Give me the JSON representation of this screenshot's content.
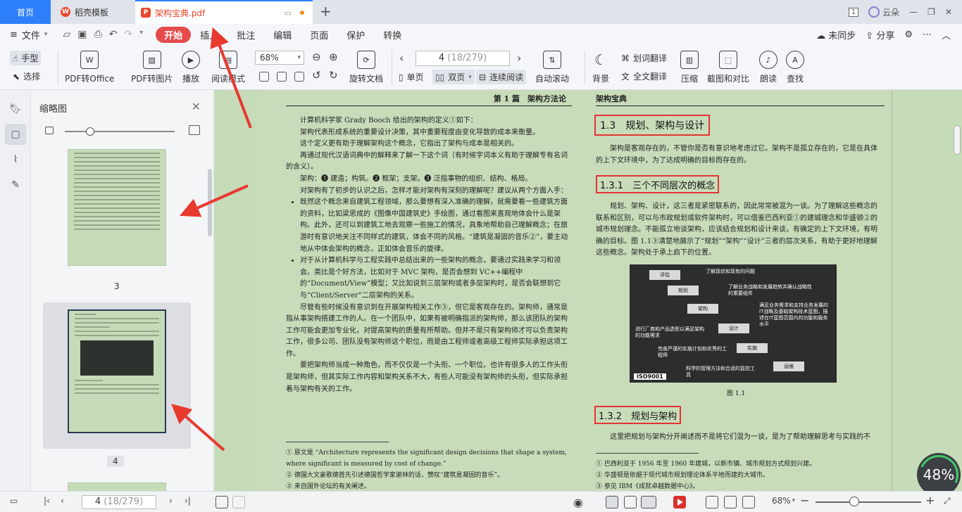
{
  "tabs": {
    "home": "首页",
    "template": "稻壳模板",
    "pdf": "架构宝典.pdf",
    "page_badge": "1",
    "user": "云朵"
  },
  "menu": {
    "file": "文件",
    "tabs": [
      "开始",
      "插入",
      "批注",
      "编辑",
      "页面",
      "保护",
      "转换"
    ],
    "sync": "未同步",
    "share": "分享"
  },
  "ribbon": {
    "hand": "手型",
    "select": "选择",
    "pdf_to_office": "PDF转Office",
    "pdf_to_image": "PDF转图片",
    "play": "播放",
    "read_mode": "阅读模式",
    "zoom": "68%",
    "rotate": "旋转文档",
    "page_current": "4",
    "page_total": "(18/279)",
    "single": "单页",
    "double": "双页",
    "continuous": "连续阅读",
    "auto_scroll": "自动滚动",
    "background": "背景",
    "word_translate": "划词翻译",
    "full_translate": "全文翻译",
    "compress": "压缩",
    "screenshot": "截图和对比",
    "read_aloud": "朗读",
    "find": "查找"
  },
  "thumbnails": {
    "title": "缩略图",
    "pages": [
      "3",
      "4"
    ],
    "selected": "4"
  },
  "left_page": {
    "header": "第 1 篇　架构方法论",
    "paragraphs": [
      "计算机科学家 Grady Booch 给出的架构的定义①如下：",
      "架构代表形成系统的重要设计决策，其中重要程度由变化导致的成本来衡量。",
      "这个定义更有助于理解架构这个概念，它指出了架构与成本是相关的。",
      "再通过现代汉语词典中的解释来了解一下这个词（有时候字词本义有助于理解专有名词的含义）。",
      "架构：❶ 建造；构筑。❷ 框架；支架。❸ 泛指事物的组织、结构、格局。",
      "对架构有了初步的认识之后，怎样才能对架构有深刻的理解呢？建议从两个方面入手："
    ],
    "bullets": [
      "既然这个概念来自建筑工程领域，那么要想有深入准确的理解，就需要看一些建筑方面的资料，比如梁思成的《图像中国建筑史》手绘图，通过看图来直观地体会什么是架构。此外，还可以到建筑工地去观察一些施工的情况，具象地帮助自己理解概念；在旅游时有意识地关注不同样式的建筑，体会不同的风格。“建筑是凝固的音乐②”，要主动地从中体会架构的概念，正如体会音乐的旋律。",
      "对于从计算机科学与工程实践中总结出来的一些架构的概念，要通过实践来学习和领会。类比是个好方法，比如对于 MVC 架构，是否会想到 VC++编程中的“Document/View”模型；又比如说到三层架构或者多层架构时，是否会联想到它与“Client/Server”二层架构的关系。"
    ],
    "paragraphs2": [
      "尽管有些时候没有意识到在开展架构相关工作③，但它是客观存在的。架构师，通常是指从事架构搭建工作的人。在一个团队中，如果有被明确指派的架构师，那么该团队的架构工作可能会更加专业化，对提高架构的质量有所帮助。但并不是只有架构师才可以负责架构工作，很多公司、团队没有架构师这个职位，而是由工程师或者高级工程师实际承担这项工作。",
      "要把架构师当成一种角色，而不仅仅是一个头衔、一个职位。也许有很多人的工作头衔是架构师，但其实际工作内容和架构关系不大，有些人可能没有架构师的头衔，但实际承担着与架构有关的工作。"
    ],
    "footnotes": [
      "① 原文是 “Architecture represents the significant design decisions that shape a system, where significant is measured by cost of change.”",
      "② 德国大文豪歌德首先引述德国哲学家谢林的话，赞叹“建筑是凝固的音乐”。",
      "③ 来自国外论坛的有关阐述。"
    ]
  },
  "right_page": {
    "header": "架构宝典",
    "h1": "1.3　规划、架构与设计",
    "p1": "架构是客观存在的，不管你是否有意识地考虑过它。架构不是孤立存在的，它是在具体的上下文环境中，为了达成明确的目标而存在的。",
    "h2a": "1.3.1　三个不同层次的概念",
    "p2": "规划、架构、设计，这三者是紧密联系的，因此常常被混为一谈。为了理解这些概念的联系和区别，可以与市政规划或软件架构时，可以借鉴巴西利亚①的建城理念和华盛顿②的城市规划理念。不能孤立地谈架构，应该结合规划和设计来谈，有确定的上下文环境，有明确的目标。图 1.1③清楚地展示了“规划”“架构”“设计”三者的层次关系，有助于更好地理解这些概念。架构处于承上启下的位置。",
    "figure": {
      "steps": [
        "评估",
        "规划",
        "架构",
        "设计",
        "实施",
        "运维"
      ],
      "notes": [
        "了解现状和现有的问题",
        "了解业务战略和发展趋势并确认战略性的重要组件",
        "满足业务需求和支持业务发展的IT战略及基础架构技术蓝图，描述在IT蓝图范围内的功能和服务水平",
        "进行厂商和产品选型以满足架构的功能需求",
        "完善严谨的实施计划和优秀的工程师",
        "科学的管理方法和合适的监控工具"
      ],
      "badge": "ISO9001",
      "caption": "图 1.1"
    },
    "h2b": "1.3.2　规划与架构",
    "p3": "这里把规划与架构分开阐述而不是将它们混为一谈，是为了帮助理解思考与实践的不",
    "footnotes": [
      "① 巴西利亚于 1956 年至 1960 年建城，以新市镇、城市规划方式规划兴建。",
      "② 华盛顿是依据于现代城市规划理论体系平地而建的大城市。",
      "③ 参见 IBM《成就卓越数据中心》。"
    ]
  },
  "status": {
    "page_current": "4",
    "page_total": "(18/279)",
    "zoom": "68%",
    "zoom_badge": "48%"
  }
}
